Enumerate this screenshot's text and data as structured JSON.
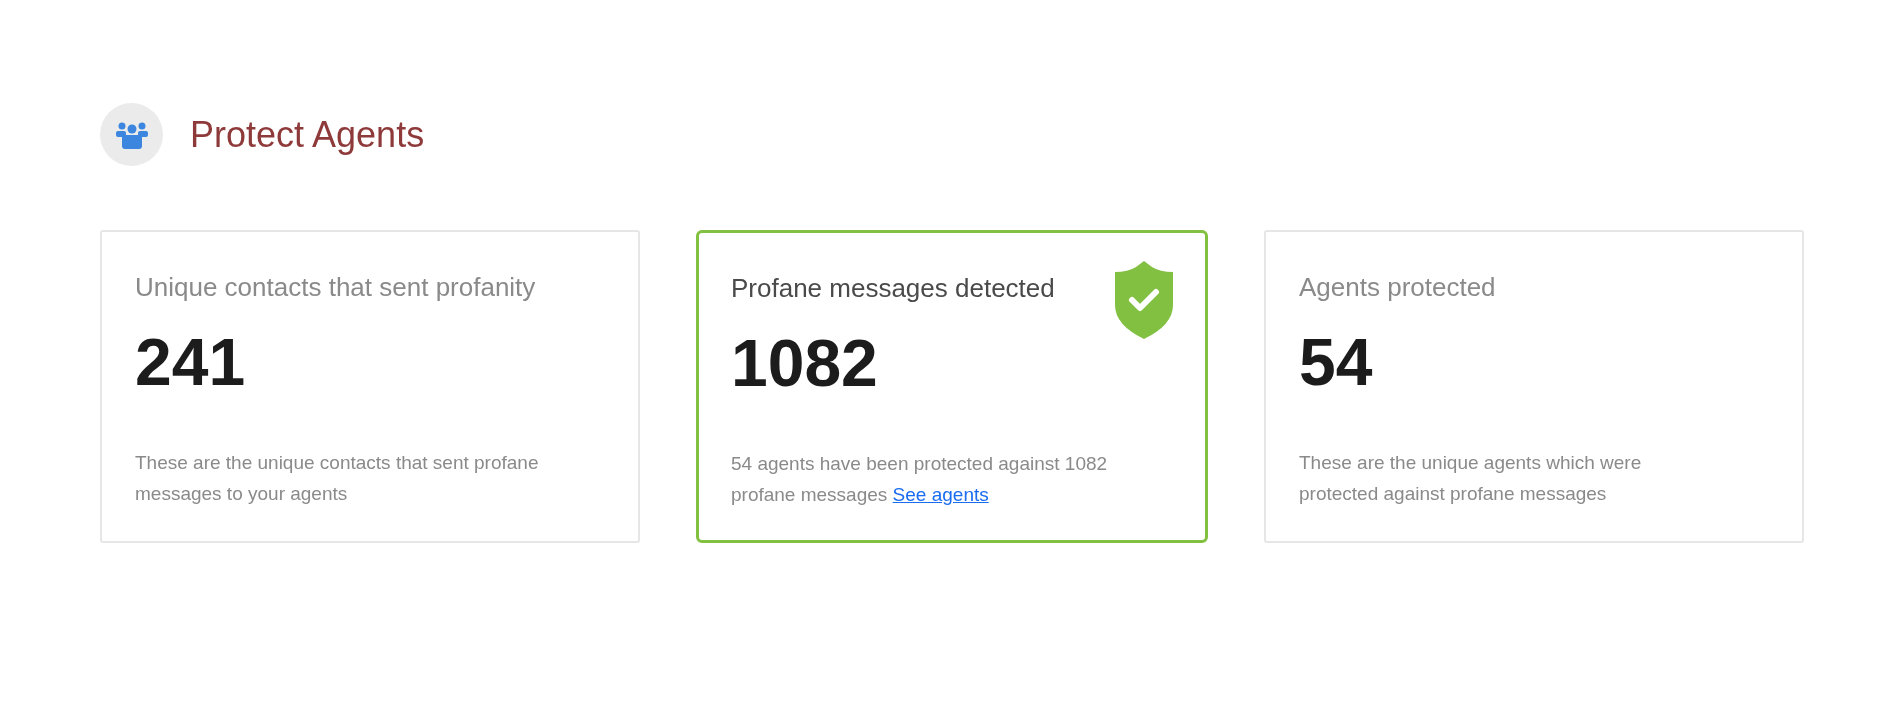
{
  "header": {
    "title": "Protect Agents"
  },
  "cards": [
    {
      "title": "Unique contacts that sent profanity",
      "value": "241",
      "description": "These are the unique contacts that sent profane messages to your agents",
      "highlighted": false
    },
    {
      "title": "Profane messages detected",
      "value": "1082",
      "description": "54 agents have been protected against 1082 profane messages",
      "link": "See agents",
      "highlighted": true
    },
    {
      "title": "Agents protected",
      "value": "54",
      "description": "These are the unique agents which were protected against profane messages",
      "highlighted": false
    }
  ]
}
